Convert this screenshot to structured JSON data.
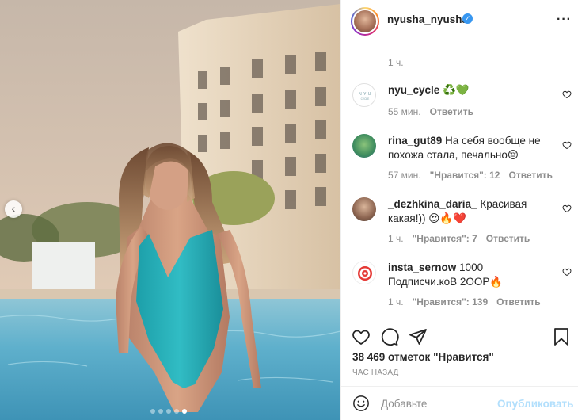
{
  "post": {
    "username": "nyusha_nyusha",
    "verified": true,
    "more_icon": "more-horizontal-icon",
    "top_comment_time": "1 ч."
  },
  "carousel": {
    "prev_icon": "chevron-left-icon",
    "slide_count": 5,
    "active_index": 4
  },
  "comments": [
    {
      "user": "nyu_cycle",
      "text": "♻️💚",
      "time": "55 мин.",
      "likes": "",
      "reply": "Ответить"
    },
    {
      "user": "rina_gut89",
      "text": "На себя вообще не похожа стала, печально😔",
      "time": "57 мин.",
      "likes": "\"Нравится\": 12",
      "reply": "Ответить"
    },
    {
      "user": "_dezhkina_daria_",
      "text": "Красивая какая!)) 😍🔥❤️",
      "time": "1 ч.",
      "likes": "\"Нравится\": 7",
      "reply": "Ответить"
    },
    {
      "user": "insta_sernow",
      "text": "1000 Подписчи.коВ 2ООР🔥",
      "time": "1 ч.",
      "likes": "\"Нравится\": 139",
      "reply": "Ответить"
    }
  ],
  "actions": {
    "like_icon": "heart-icon",
    "comment_icon": "comment-icon",
    "share_icon": "share-icon",
    "save_icon": "bookmark-icon"
  },
  "likes_text": "38 469 отметок \"Нравится\"",
  "date_text": "ЧАС НАЗАД",
  "comment_box": {
    "emoji_icon": "smile-icon",
    "placeholder": "Добавьте",
    "publish_label": "Опубликовать"
  },
  "colors": {
    "verified": "#3897f0",
    "publish_disabled": "#b2dffc",
    "meta_gray": "#8e8e8e"
  }
}
